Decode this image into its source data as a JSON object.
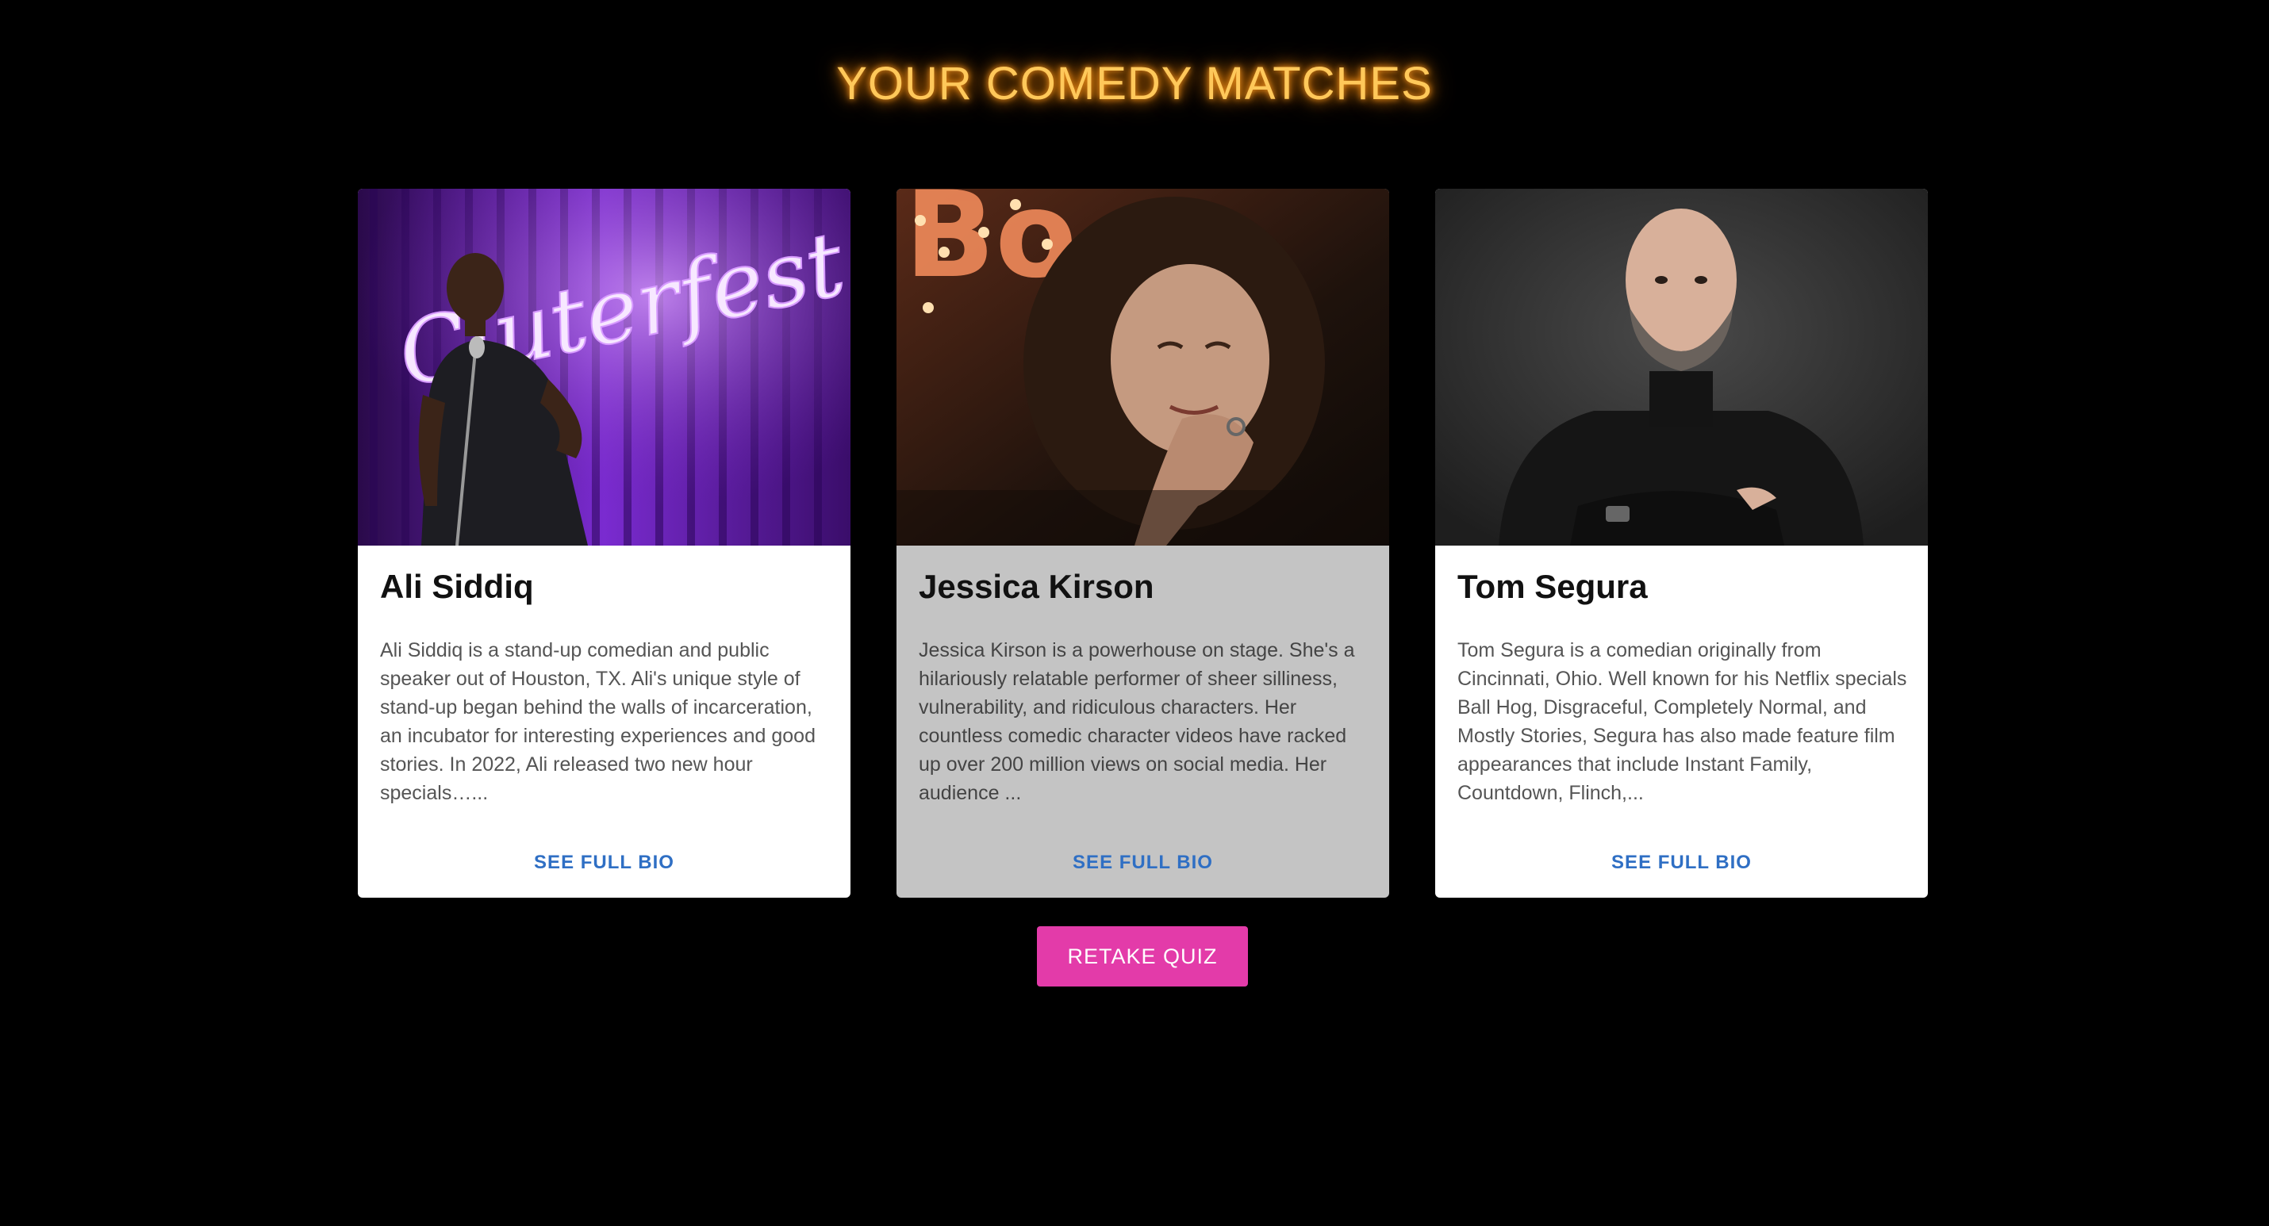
{
  "page": {
    "title": "YOUR COMEDY MATCHES",
    "accent_color": "#ffc85a",
    "retake_label": "RETAKE QUIZ",
    "retake_color": "#e33ba9"
  },
  "matches": [
    {
      "name": "Ali Siddiq",
      "bio": "Ali Siddiq is a stand-up comedian and public speaker out of Houston, TX. Ali's unique style of stand-up began behind the walls of incarceration, an incubator for interesting experiences and good stories. In 2022, Ali released two new hour specials…...",
      "link_label": "SEE FULL BIO",
      "photo": "comedian-photo-neon-stage",
      "photo_sign_text": "Cluterfest"
    },
    {
      "name": "Jessica Kirson",
      "bio": "Jessica Kirson is a powerhouse on stage. She's a hilariously relatable performer of sheer silliness, vulnerability, and ridiculous characters. Her countless comedic character videos have racked up over 200 million views on social media. Her audience ...",
      "link_label": "SEE FULL BIO",
      "photo": "comedian-photo-marquee",
      "photo_sign_text": "Bo"
    },
    {
      "name": "Tom Segura",
      "bio": "Tom Segura is a comedian originally from Cincinnati, Ohio. Well known for his Netflix specials Ball Hog, Disgraceful, Completely Normal, and Mostly Stories, Segura has also made feature film appearances that include Instant Family, Countdown, Flinch,...",
      "link_label": "SEE FULL BIO",
      "photo": "comedian-photo-studio-portrait"
    }
  ]
}
